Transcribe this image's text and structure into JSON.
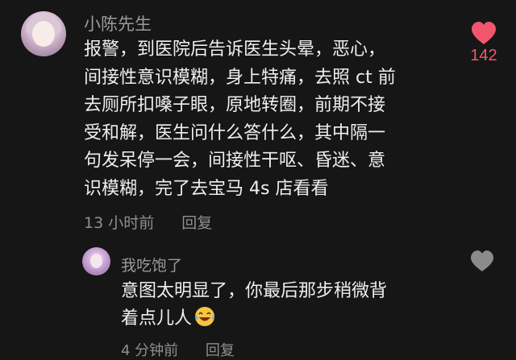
{
  "colors": {
    "background": "#161616",
    "like_active": "#f2566c",
    "like_inactive": "#8b8b8b",
    "username": "#9a9a9a",
    "meta": "#8f8f8f",
    "text": "#efefef"
  },
  "comment": {
    "username": "小陈先生",
    "avatar_icon": "avatar-icon",
    "body_lines": [
      "报警，到医院后告诉医生头晕，恶心，",
      "间接性意识模糊，身上特痛，去照 ct 前",
      "去厕所扣嗓子眼，原地转圈，前期不接",
      "受和解，医生问什么答什么，其中隔一",
      "句发呆停一会，间接性干呕、昏迷、意",
      "识模糊，完了去宝马 4s 店看看"
    ],
    "time": "13 小时前",
    "reply_label": "回复",
    "likes": "142",
    "liked": true,
    "like_icon": "heart-filled-icon"
  },
  "reply": {
    "username": "我吃饱了",
    "avatar_icon": "avatar-icon",
    "body_lines": [
      "意图太明显了，你最后那步稍微背",
      "着点儿人"
    ],
    "emoji_icon": "laughing-tears-emoji-icon",
    "time": "4 分钟前",
    "reply_label": "回复",
    "liked": false,
    "like_icon": "heart-outline-icon"
  }
}
